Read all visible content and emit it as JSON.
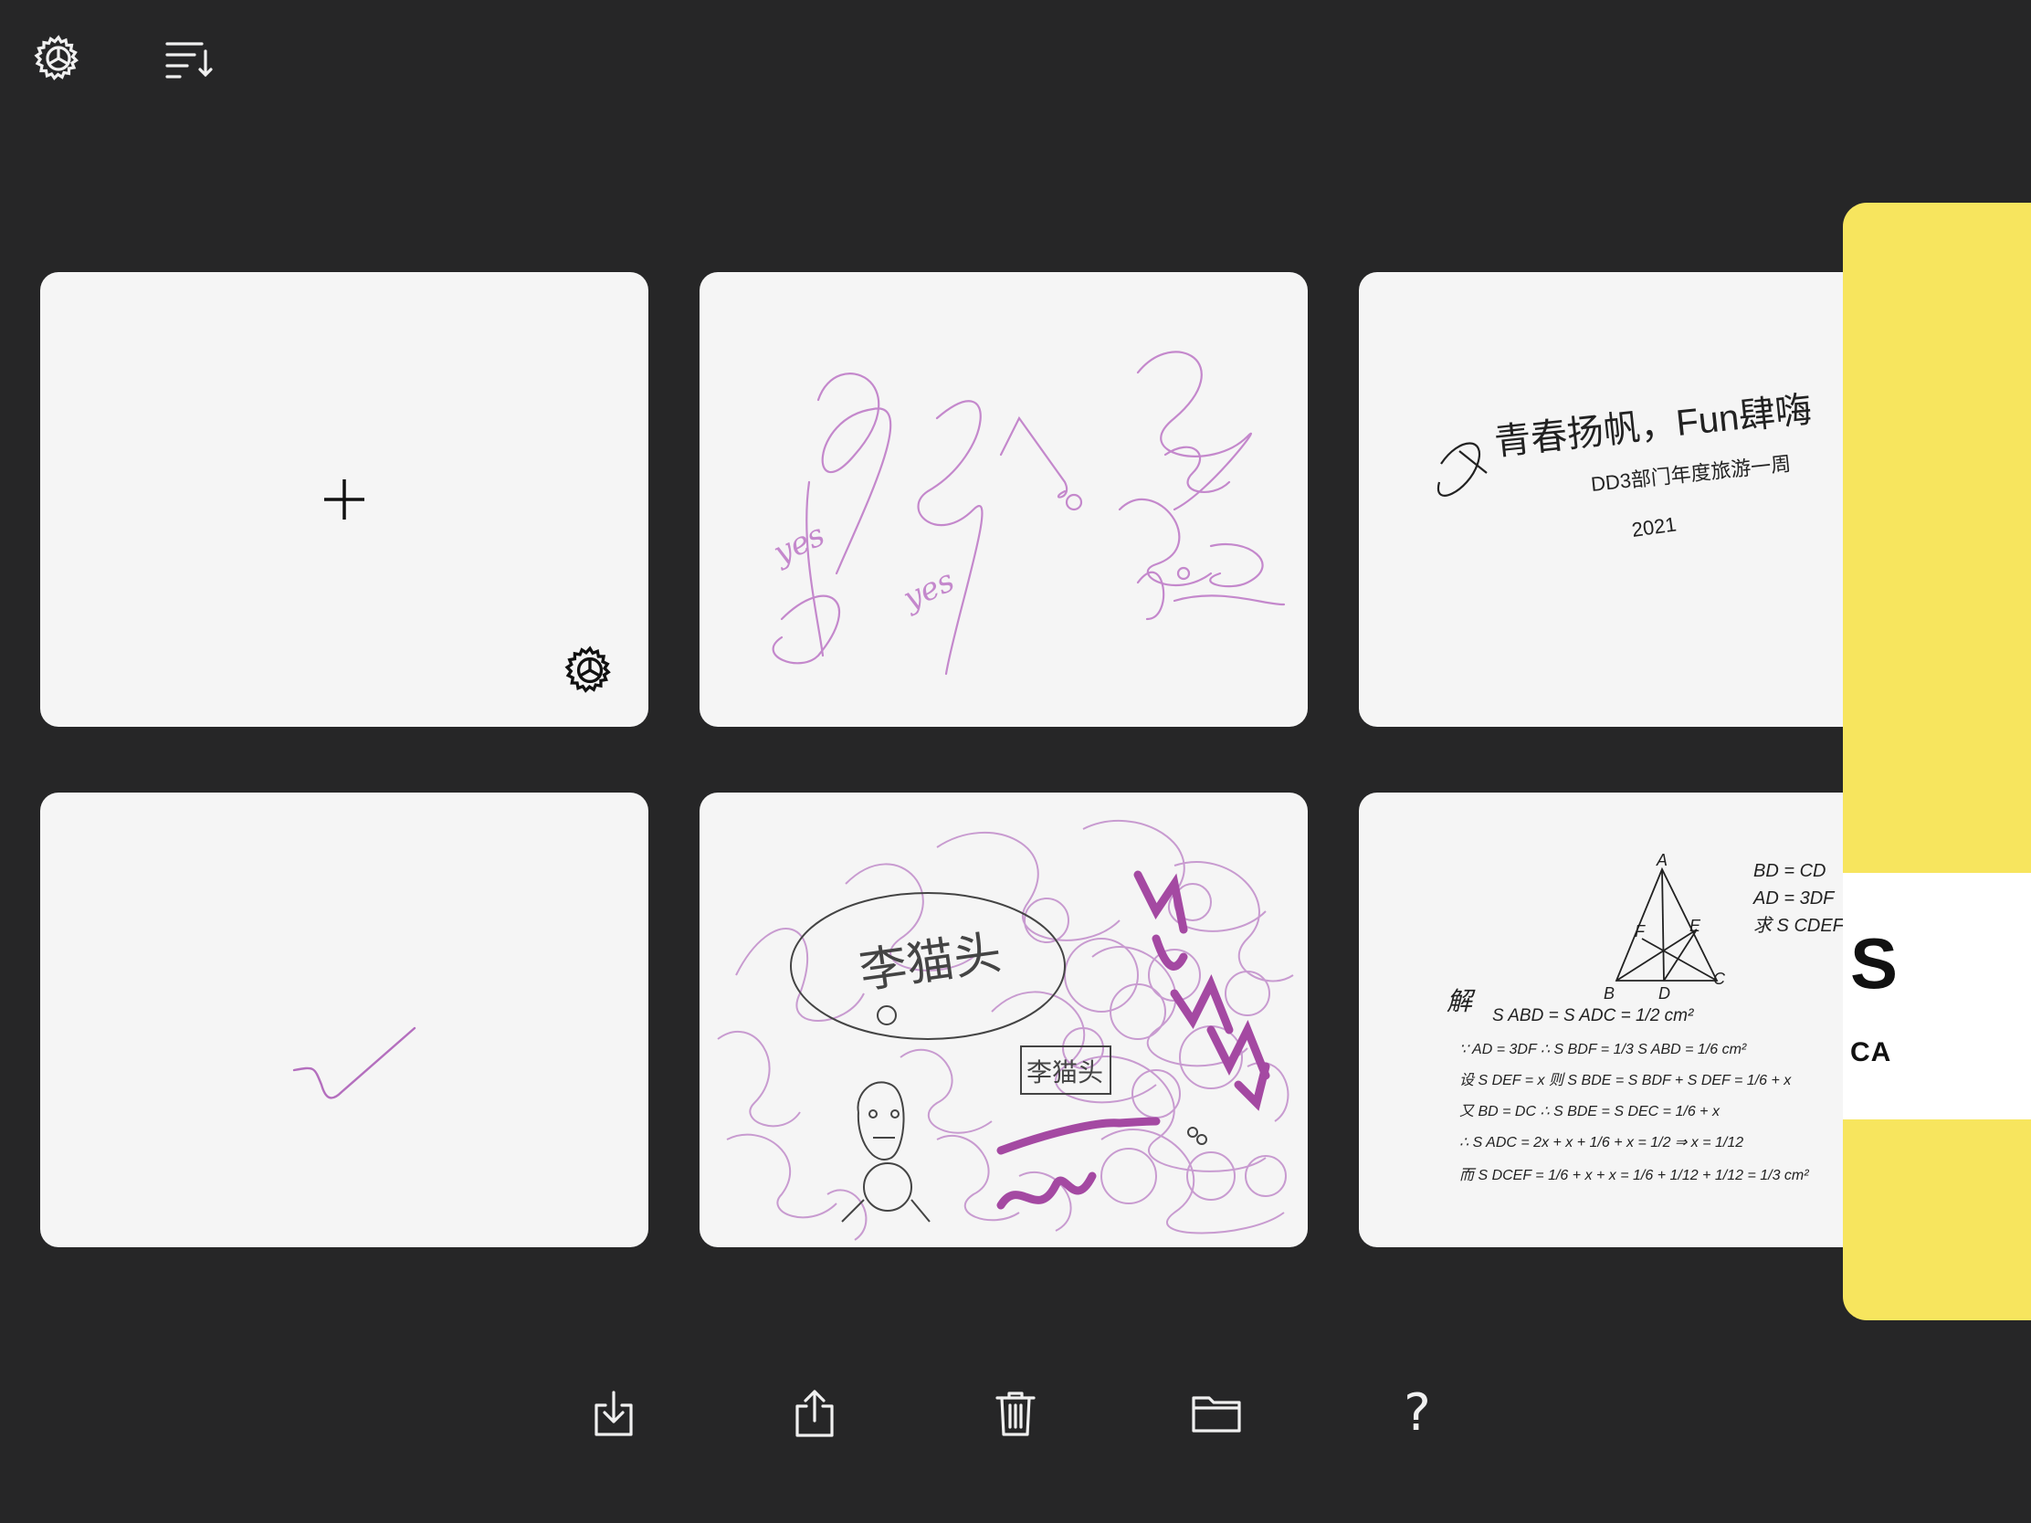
{
  "toolbar": {
    "settings_icon": "gear-icon",
    "sort_icon": "sort-descending-icon"
  },
  "notes": [
    {
      "type": "new",
      "plus_icon": "plus-icon",
      "settings_icon": "gear-icon"
    },
    {
      "type": "sketch",
      "ink_color": "#b46fbe",
      "texts": [
        "yes",
        "yes"
      ]
    },
    {
      "type": "sketch",
      "ink_color": "#222222",
      "texts": [
        "青春扬帆，Fun肆嗨",
        "DD3部门年度旅游一周",
        "2021"
      ]
    },
    {
      "type": "sketch",
      "ink_color": "#b46fbe",
      "texts": []
    },
    {
      "type": "sketch",
      "ink_color": "#a449a2",
      "texts": [
        "李猫头",
        "李猫头"
      ]
    },
    {
      "type": "sketch",
      "ink_color": "#222222",
      "texts": [
        "A",
        "B",
        "C",
        "D",
        "E",
        "F",
        "BD = CD",
        "AD = 3DF",
        "求 S CDEF",
        "解",
        "S ABD = S ADC = 1/2 cm²",
        "∵ AD = 3DF ∴ S BDF = 1/3 S ABD = 1/6 cm²",
        "设 S DEF = x 则 S BDE = S BDF + S DEF = 1/6 + x",
        "又 BD = DC ∴ S BDE = S DEC = 1/6 + x",
        "∴ S ADC = 2x + x + 1/6 + x = 1/2 ⇒ x = 1/12",
        "而 S DCEF = 1/6 + x + x = 1/6 + 1/12 + 1/12 = 1/3 cm²"
      ]
    }
  ],
  "side_panel": {
    "big_text": "S",
    "small_text": "CA",
    "color": "#f7e55e"
  },
  "bottom_bar": {
    "import_icon": "import-icon",
    "share_icon": "share-icon",
    "trash_icon": "trash-icon",
    "folder_icon": "folder-icon",
    "help_label": "?"
  }
}
